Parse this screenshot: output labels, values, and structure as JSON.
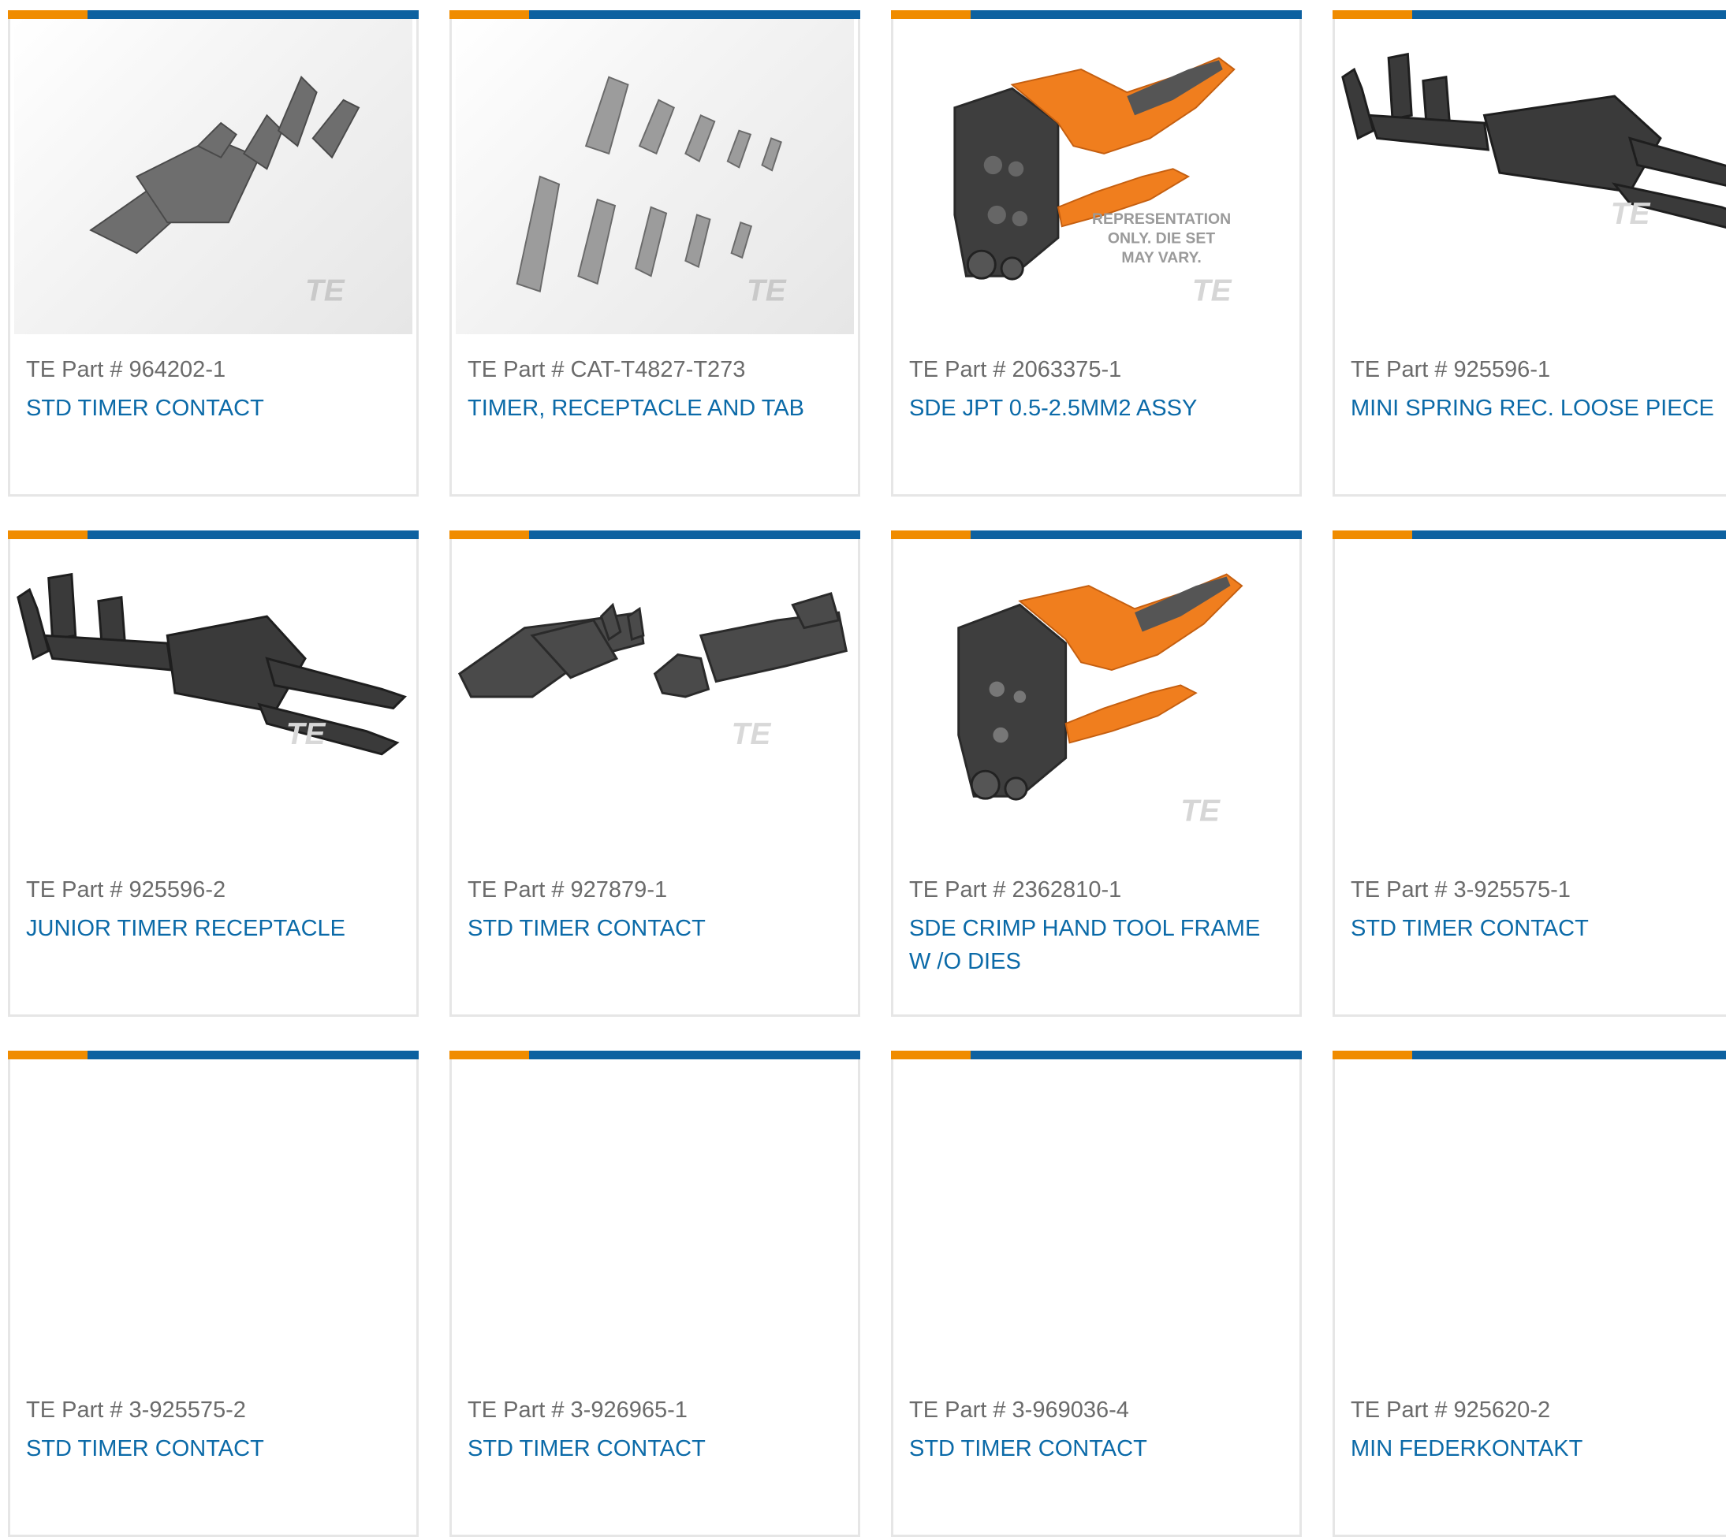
{
  "products": [
    {
      "part_label": "TE Part # 964202-1",
      "title": "STD TIMER CONTACT",
      "image": "contact-metal"
    },
    {
      "part_label": "TE Part # CAT-T4827-T273",
      "title": "TIMER, RECEPTACLE AND TAB",
      "image": "kit-multiple"
    },
    {
      "part_label": "TE Part # 2063375-1",
      "title": "SDE JPT 0.5-2.5mm2 ASSY",
      "image": "crimp-tool",
      "overlay_text": [
        "REPRESENTATION",
        "ONLY. DIE SET",
        "MAY VARY."
      ]
    },
    {
      "part_label": "TE Part # 925596-1",
      "title": "MINI SPRING REC. LOOSE PIECE",
      "image": "receptacle-dark"
    },
    {
      "part_label": "TE Part # 925596-2",
      "title": "JUNIOR TIMER RECEPTACLE",
      "image": "receptacle-dark"
    },
    {
      "part_label": "TE Part # 927879-1",
      "title": "STD TIMER CONTACT",
      "image": "two-contacts"
    },
    {
      "part_label": "TE Part # 2362810-1",
      "title": "SDE CRIMP HAND TOOL FRAME W /O DIES",
      "image": "crimp-tool"
    },
    {
      "part_label": "TE Part # 3-925575-1",
      "title": "STD TIMER CONTACT",
      "image": ""
    },
    {
      "part_label": "TE Part # 3-925575-2",
      "title": "STD TIMER CONTACT",
      "image": ""
    },
    {
      "part_label": "TE Part # 3-926965-1",
      "title": "STD TIMER CONTACT",
      "image": ""
    },
    {
      "part_label": "TE Part # 3-969036-4",
      "title": "STD TIMER CONTACT",
      "image": ""
    },
    {
      "part_label": "TE Part # 925620-2",
      "title": "MIN FEDERKONTAKT",
      "image": ""
    }
  ],
  "watermark": "TE",
  "colors": {
    "accent_orange": "#f08c00",
    "accent_blue": "#0d61a0",
    "link": "#0b6aa8",
    "tool_orange": "#f07e1e"
  }
}
